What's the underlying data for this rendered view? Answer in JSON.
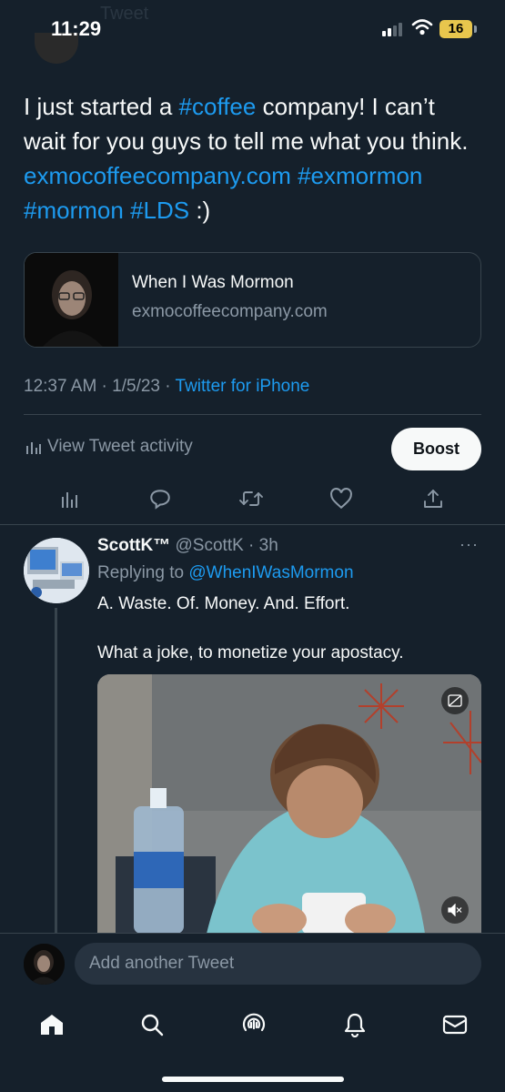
{
  "status_bar": {
    "time": "11:29",
    "battery": "16",
    "faded_header": "Tweet"
  },
  "tweet": {
    "text_parts": [
      {
        "text": "I just started a ",
        "link": false
      },
      {
        "text": "#coffee",
        "link": true
      },
      {
        "text": " company! I can’t wait for you guys to tell me what you think. ",
        "link": false
      },
      {
        "text": "exmocoffeecompany.com",
        "link": true
      },
      {
        "text": " ",
        "link": false
      },
      {
        "text": "#exmormon",
        "link": true
      },
      {
        "text": " ",
        "link": false
      },
      {
        "text": "#mormon",
        "link": true
      },
      {
        "text": " ",
        "link": false
      },
      {
        "text": "#LDS",
        "link": true
      },
      {
        "text": " :)",
        "link": false
      }
    ],
    "card": {
      "title": "When I Was Mormon",
      "domain": "exmocoffeecompany.com"
    },
    "timestamp": "12:37 AM · 1/5/23 · ",
    "source": "Twitter for iPhone",
    "activity_label": "View Tweet activity",
    "boost_label": "Boost"
  },
  "reply": {
    "name": "ScottK™",
    "handle_time": " @ScottK · 3h",
    "replying_prefix": "Replying to ",
    "replying_handle": "@WhenIWasMormon",
    "line1": "A. Waste. Of. Money. And. Effort.",
    "line2": "What a joke, to monetize your apostacy.",
    "more": "···"
  },
  "composer": {
    "placeholder": "Add another Tweet"
  },
  "icons": {
    "actions": [
      "bar-chart-icon",
      "reply-icon",
      "retweet-icon",
      "like-icon",
      "share-icon"
    ],
    "tabs": [
      "home-icon",
      "search-icon",
      "spaces-icon",
      "notifications-icon",
      "messages-icon"
    ]
  },
  "colors": {
    "background": "#15202b",
    "accent": "#1d9bf0",
    "text": "#f7f9f9",
    "secondary_text": "#8b98a5"
  }
}
